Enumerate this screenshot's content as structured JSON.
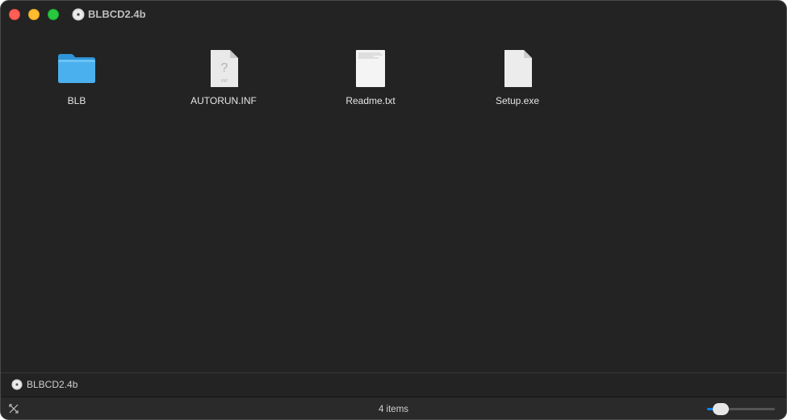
{
  "window": {
    "title": "BLBCD2.4b",
    "title_icon": "cd-disc-icon"
  },
  "files": [
    {
      "name": "BLB",
      "icon": "folder-icon",
      "kind": "folder"
    },
    {
      "name": "AUTORUN.INF",
      "icon": "unknown-document-icon",
      "kind": "inf",
      "badge": "INF"
    },
    {
      "name": "Readme.txt",
      "icon": "text-document-icon",
      "kind": "txt"
    },
    {
      "name": "Setup.exe",
      "icon": "generic-document-icon",
      "kind": "exe"
    }
  ],
  "pathbar": {
    "label": "BLBCD2.4b",
    "icon": "cd-disc-icon"
  },
  "statusbar": {
    "item_count": "4 items",
    "icon_size_slider": 0.2
  },
  "colors": {
    "window_bg": "#232323",
    "close": "#ff5f57",
    "minimize": "#febc2e",
    "zoom": "#28c840",
    "folder": "#4ab0ee",
    "accent": "#0a84ff"
  }
}
